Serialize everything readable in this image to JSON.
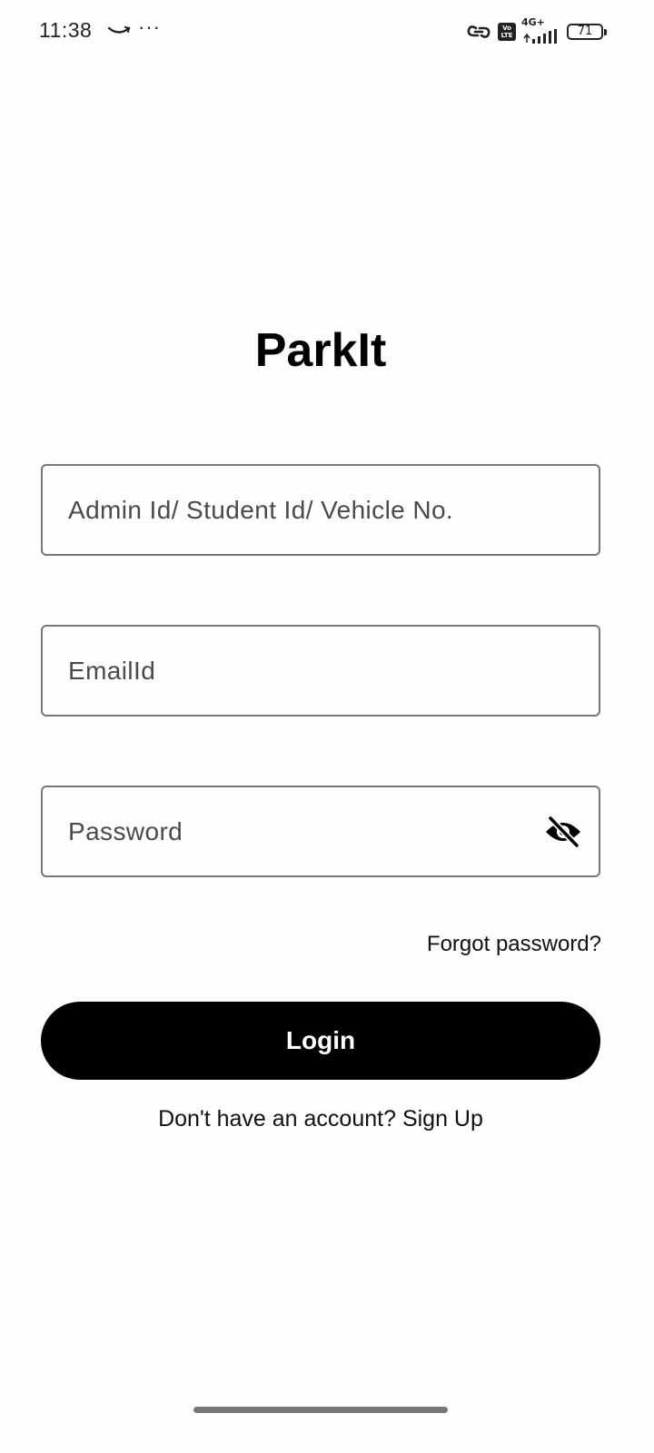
{
  "status_bar": {
    "time": "11:38",
    "more_dots": "···",
    "volte_top": "Vo",
    "volte_bottom": "LTE",
    "network_type": "4G+",
    "battery_level": "71"
  },
  "app": {
    "title": "ParkIt"
  },
  "form": {
    "admin_field_placeholder": "Admin Id/ Student Id/ Vehicle No.",
    "email_field_placeholder": "EmailId",
    "password_field_placeholder": "Password",
    "forgot_password_label": "Forgot password?",
    "login_label": "Login",
    "signup_prompt": "Don't have an account?",
    "signup_label": "Sign Up"
  },
  "icons": {
    "password_toggle": "eye-off-icon",
    "connection": "link-icon"
  }
}
